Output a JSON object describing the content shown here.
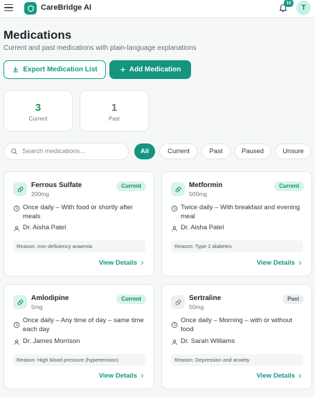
{
  "header": {
    "brand": "CareBridge AI",
    "notification_count": "10",
    "avatar_initial": "T",
    "accent_color": "#119a83"
  },
  "page": {
    "title": "Medications",
    "subtitle": "Current and past medications with plain-language explanations"
  },
  "actions": {
    "export_label": "Export Medication List",
    "add_label": "Add Medication"
  },
  "stats": [
    {
      "value": "3",
      "label": "Current",
      "color": "#1a9a4f"
    },
    {
      "value": "1",
      "label": "Past",
      "color": "#6b797d"
    }
  ],
  "search": {
    "placeholder": "Search medications..."
  },
  "filters": [
    "All",
    "Current",
    "Past",
    "Paused",
    "Unsure"
  ],
  "active_filter": "All",
  "medications": [
    {
      "name": "Ferrous Sulfate",
      "dose": "200mg",
      "status": "Current",
      "frequency": "Once daily – With food or shortly after meals",
      "doctor": "Dr. Aisha Patel",
      "reason": "Reason: Iron deficiency anaemia",
      "details_label": "View Details"
    },
    {
      "name": "Metformin",
      "dose": "500mg",
      "status": "Current",
      "frequency": "Twice daily – With breakfast and evening meal",
      "doctor": "Dr. Aisha Patel",
      "reason": "Reason: Type 2 diabetes",
      "details_label": "View Details"
    },
    {
      "name": "Amlodipine",
      "dose": "5mg",
      "status": "Current",
      "frequency": "Once daily – Any time of day – same time each day",
      "doctor": "Dr. James Morrison",
      "reason": "Reason: High blood pressure (hypertension)",
      "details_label": "View Details"
    },
    {
      "name": "Sertraline",
      "dose": "50mg",
      "status": "Past",
      "frequency": "Once daily – Morning – with or without food",
      "doctor": "Dr. Sarah Williams",
      "reason": "Reason: Depression and anxiety",
      "details_label": "View Details"
    }
  ]
}
